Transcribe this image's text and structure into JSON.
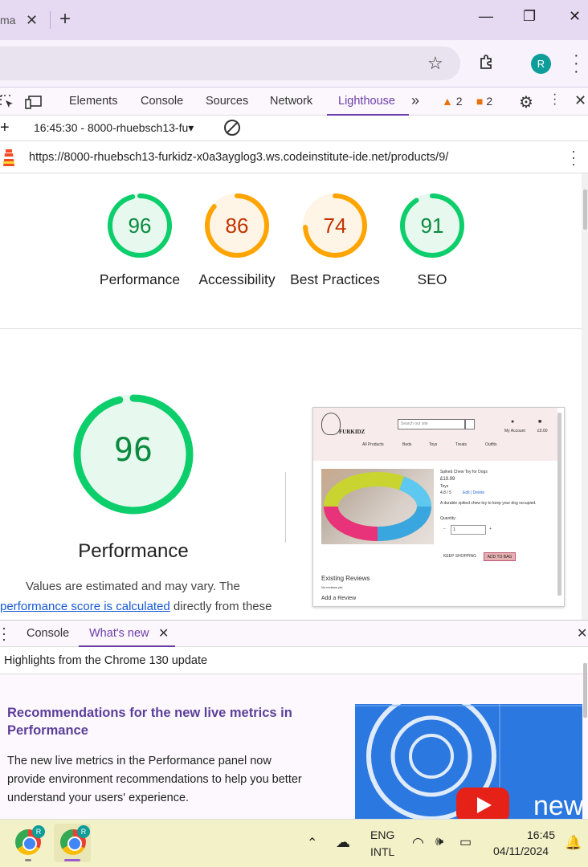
{
  "browser": {
    "tab_title_fragment": "ma",
    "avatar_initial": "R"
  },
  "devtools": {
    "tabs": [
      "Elements",
      "Console",
      "Sources",
      "Network",
      "Lighthouse"
    ],
    "warnings_count": "2",
    "issues_count": "2",
    "report_selector": "16:45:30 - 8000-rhuebsch13-fu",
    "audited_url": "https://8000-rhuebsch13-furkidz-x0a3ayglog3.ws.codeinstitute-ide.net/products/9/"
  },
  "lighthouse": {
    "scores": [
      {
        "label": "Performance",
        "value": "96",
        "color": "#0cce6b",
        "text_color": "#0a8a3e",
        "fill": "#e7f8ee"
      },
      {
        "label": "Accessibility",
        "value": "86",
        "color": "#ffa400",
        "text_color": "#c33300",
        "fill": "#fff5e6"
      },
      {
        "label": "Best Practices",
        "value": "74",
        "color": "#ffa400",
        "text_color": "#c33300",
        "fill": "#fff5e6"
      },
      {
        "label": "SEO",
        "value": "91",
        "color": "#0cce6b",
        "text_color": "#0a8a3e",
        "fill": "#e7f8ee"
      }
    ],
    "big_score": "96",
    "big_title": "Performance",
    "note_line1": "Values are estimated and may vary. The",
    "note_link": "performance score is calculated",
    "note_line2_rest": " directly from these",
    "thumbnail": {
      "brand": "FURKIDZ",
      "search_placeholder": "Search our site",
      "account": "My Account",
      "bag": "£0.00",
      "nav": [
        "All Products",
        "Beds",
        "Toys",
        "Treats",
        "Outfits"
      ],
      "product_name": "Spiked Chew Toy for Dogs",
      "price": "£19.99",
      "category": "Toys",
      "rating": "4.8 / 5",
      "edit_delete": "Edit | Delete",
      "description": "A durable spiked chew toy to keep your dog occupied.",
      "quantity_label": "Quantity:",
      "quantity_value": "1",
      "keep_shopping": "KEEP SHOPPING",
      "add_to_bag": "ADD TO BAG",
      "reviews_heading": "Existing Reviews",
      "no_reviews": "No reviews yet.",
      "add_review": "Add a Review"
    }
  },
  "drawer": {
    "tabs": [
      "Console",
      "What's new"
    ],
    "highlights": "Highlights from the Chrome 130 update",
    "heading": "Recommendations for the new live metrics in Performance",
    "body": "The new live metrics in the Performance panel now provide environment recommendations to help you better understand your users' experience.",
    "video_text": "new"
  },
  "taskbar": {
    "lang_top": "ENG",
    "lang_bottom": "INTL",
    "time": "16:45",
    "date": "04/11/2024",
    "profile_initial": "R"
  }
}
